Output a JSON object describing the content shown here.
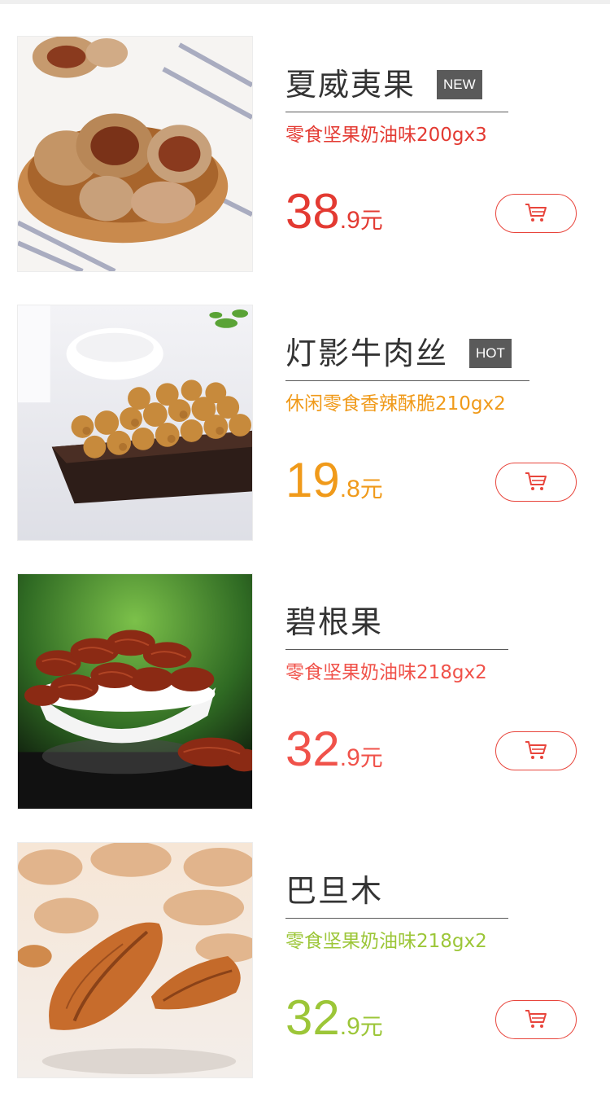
{
  "products": [
    {
      "name": "夏威夷果",
      "badge": "NEW",
      "description": "零食坚果奶油味200gx3",
      "price_int": "38",
      "price_dec": ".9",
      "unit": "元",
      "accent": "#e33a32",
      "image": "pecans-in-wooden-bowl"
    },
    {
      "name": "灯影牛肉丝",
      "badge": "HOT",
      "description": "休闲零食香辣酥脆210gx2",
      "price_int": "19",
      "price_dec": ".8",
      "unit": "元",
      "accent": "#f09a1a",
      "image": "fried-peanuts-in-dish"
    },
    {
      "name": "碧根果",
      "badge": "",
      "description": "零食坚果奶油味218gx2",
      "price_int": "32",
      "price_dec": ".9",
      "unit": "元",
      "accent": "#f0524a",
      "image": "pecan-kernels-in-white-bowl"
    },
    {
      "name": "巴旦木",
      "badge": "",
      "description": "零食坚果奶油味218gx2",
      "price_int": "32",
      "price_dec": ".9",
      "unit": "元",
      "accent": "#9cc638",
      "image": "almonds-closeup"
    }
  ],
  "cart_button": {
    "icon": "cart-icon",
    "border_color": "#e8453c"
  }
}
